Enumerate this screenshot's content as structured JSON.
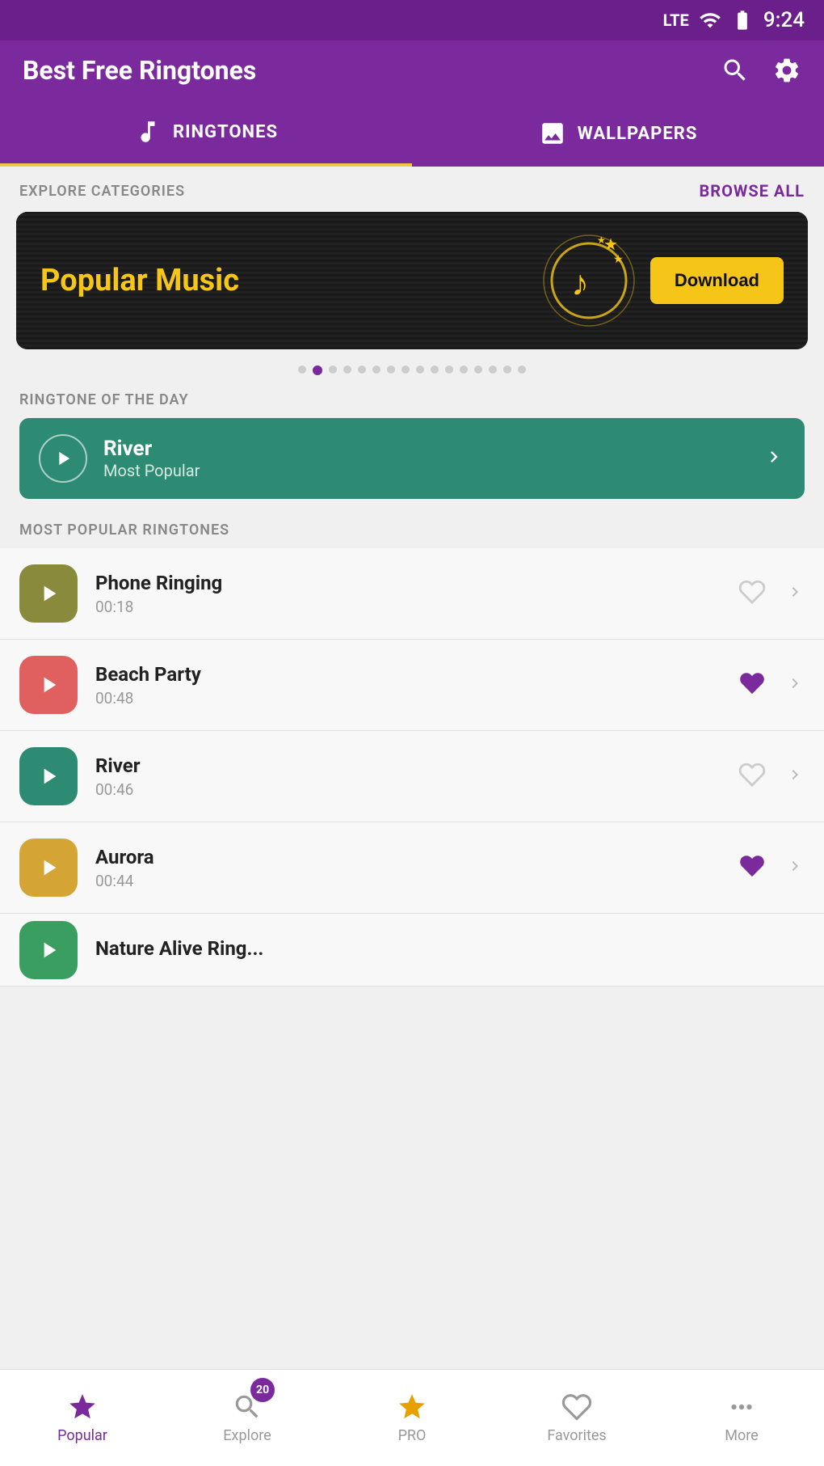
{
  "statusBar": {
    "lte": "LTE",
    "battery": "🔋",
    "time": "9:24"
  },
  "header": {
    "title": "Best Free Ringtones",
    "searchIconLabel": "search-icon",
    "settingsIconLabel": "settings-icon"
  },
  "tabs": [
    {
      "id": "ringtones",
      "label": "RINGTONES",
      "active": true
    },
    {
      "id": "wallpapers",
      "label": "WALLPAPERS",
      "active": false
    }
  ],
  "exploreSection": {
    "title": "EXPLORE CATEGORIES",
    "browseAll": "BROWSE ALL"
  },
  "banner": {
    "text": "Popular Music",
    "downloadLabel": "Download"
  },
  "dots": {
    "total": 16,
    "activeIndex": 1
  },
  "ringtoneOfDay": {
    "sectionTitle": "RINGTONE OF THE DAY",
    "name": "River",
    "subtitle": "Most Popular"
  },
  "mostPopular": {
    "sectionTitle": "MOST POPULAR RINGTONES",
    "items": [
      {
        "id": 1,
        "name": "Phone Ringing",
        "duration": "00:18",
        "color": "#8a8a3c",
        "liked": false
      },
      {
        "id": 2,
        "name": "Beach Party",
        "duration": "00:48",
        "color": "#e06060",
        "liked": true
      },
      {
        "id": 3,
        "name": "River",
        "duration": "00:46",
        "color": "#2e8b73",
        "liked": false
      },
      {
        "id": 4,
        "name": "Aurora",
        "duration": "00:44",
        "color": "#d4a435",
        "liked": true
      }
    ]
  },
  "bottomNav": [
    {
      "id": "popular",
      "label": "Popular",
      "active": true,
      "badge": null
    },
    {
      "id": "explore",
      "label": "Explore",
      "active": false,
      "badge": "20"
    },
    {
      "id": "pro",
      "label": "PRO",
      "active": false,
      "badge": null
    },
    {
      "id": "favorites",
      "label": "Favorites",
      "active": false,
      "badge": null
    },
    {
      "id": "more",
      "label": "More",
      "active": false,
      "badge": null
    }
  ]
}
